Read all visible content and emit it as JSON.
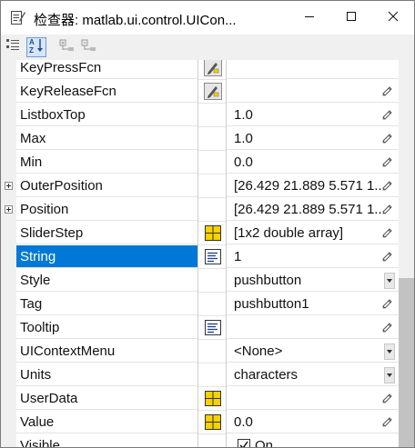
{
  "window": {
    "title": "检查器: matlab.ui.control.UICon...",
    "app_icon": "pencil-edit-icon",
    "controls": {
      "minimize": "minimize-icon",
      "maximize": "maximize-icon",
      "close": "close-icon"
    }
  },
  "toolbar": {
    "buttons": [
      {
        "name": "categorized-view-button",
        "icon": "categorize-icon",
        "active": false
      },
      {
        "name": "alphabetical-sort-button",
        "icon": "sort-az-icon",
        "active": true
      },
      {
        "name": "expand-all-button",
        "icon": "expand-all-icon",
        "active": false
      },
      {
        "name": "collapse-all-button",
        "icon": "collapse-all-icon",
        "active": false
      }
    ]
  },
  "properties": [
    {
      "name": "KeyPressFcn",
      "value": "",
      "editor": "callback",
      "action": "none"
    },
    {
      "name": "KeyReleaseFcn",
      "value": "",
      "editor": "callback",
      "action": "pencil"
    },
    {
      "name": "ListboxTop",
      "value": "1.0",
      "editor": "",
      "action": "pencil"
    },
    {
      "name": "Max",
      "value": "1.0",
      "editor": "",
      "action": "pencil"
    },
    {
      "name": "Min",
      "value": "0.0",
      "editor": "",
      "action": "pencil"
    },
    {
      "name": "OuterPosition",
      "value": "[26.429 21.889 5.571 1...",
      "editor": "",
      "action": "pencil",
      "expandable": true
    },
    {
      "name": "Position",
      "value": "[26.429 21.889 5.571 1...",
      "editor": "",
      "action": "pencil",
      "expandable": true
    },
    {
      "name": "SliderStep",
      "value": "[1x2  double array]",
      "editor": "array",
      "action": "pencil"
    },
    {
      "name": "String",
      "value": "1",
      "editor": "text",
      "action": "pencil",
      "selected": true
    },
    {
      "name": "Style",
      "value": "pushbutton",
      "editor": "",
      "action": "dropdown"
    },
    {
      "name": "Tag",
      "value": "pushbutton1",
      "editor": "",
      "action": "pencil"
    },
    {
      "name": "Tooltip",
      "value": "",
      "editor": "text",
      "action": "pencil"
    },
    {
      "name": "UIContextMenu",
      "value": "<None>",
      "editor": "",
      "action": "dropdown"
    },
    {
      "name": "Units",
      "value": "characters",
      "editor": "",
      "action": "dropdown"
    },
    {
      "name": "UserData",
      "value": "",
      "editor": "array",
      "action": "pencil"
    },
    {
      "name": "Value",
      "value": "0.0",
      "editor": "array",
      "action": "pencil"
    },
    {
      "name": "Visible",
      "value": "On",
      "editor": "",
      "action": "none",
      "checkbox": true,
      "checked": true
    }
  ],
  "colors": {
    "selection": "#0078d7",
    "gutter": "#f0f0f0",
    "array_icon": "#f5d200"
  }
}
